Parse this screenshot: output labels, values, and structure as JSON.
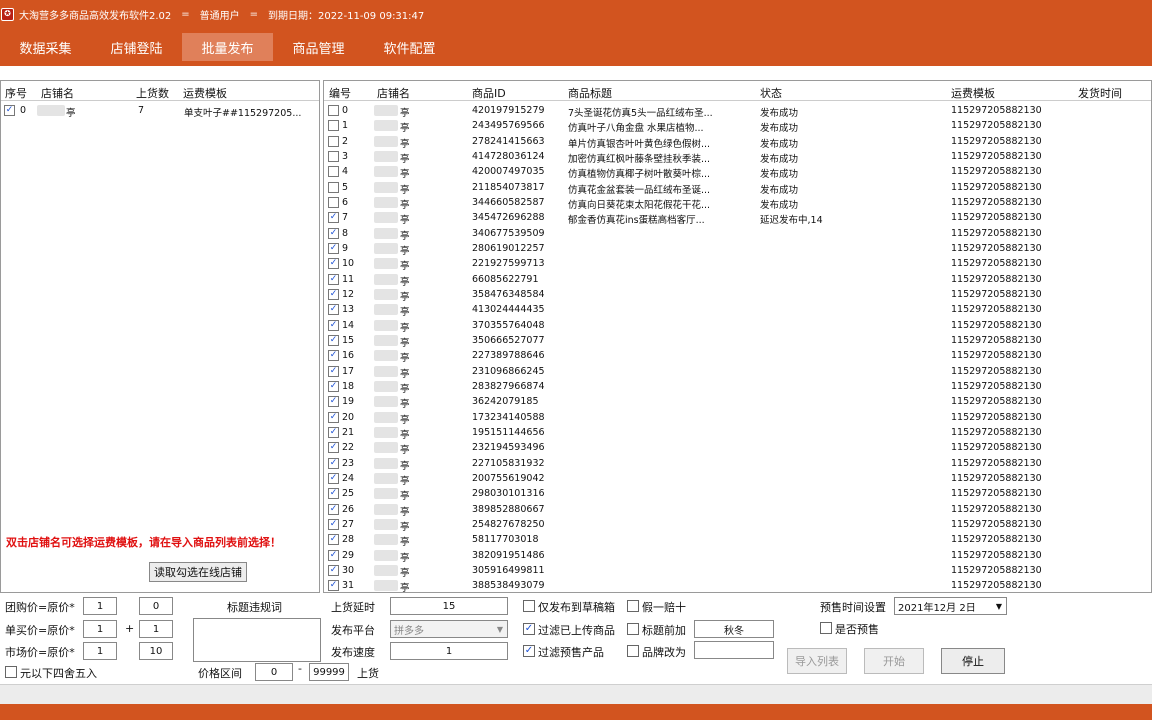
{
  "window": {
    "title": "大淘营多多商品高效发布软件2.02",
    "sep1": "=",
    "user": "普通用户",
    "sep2": "=",
    "expiry": "到期日期：2022-11-09 09:31:47"
  },
  "nav": {
    "tabs": [
      {
        "label": "数据采集"
      },
      {
        "label": "店铺登陆"
      },
      {
        "label": "批量发布",
        "active": true
      },
      {
        "label": "商品管理"
      },
      {
        "label": "软件配置"
      }
    ]
  },
  "left": {
    "columns": [
      "序号",
      "店铺名",
      "上货数",
      "运费模板"
    ],
    "rows": [
      {
        "checked": true,
        "no": "0",
        "shop": "亭",
        "count": "7",
        "template": "单支叶子##115297205..."
      }
    ],
    "hint": "双击店铺名可选择运费模板，请在导入商品列表前选择！",
    "read_button": "读取勾选在线店铺"
  },
  "right": {
    "columns": [
      "编号",
      "店铺名",
      "商品ID",
      "商品标题",
      "状态",
      "运费模板",
      "发货时间"
    ],
    "rows": [
      {
        "checked": false,
        "no": "0",
        "shop": "亭",
        "id": "420197915279",
        "title": "7头圣诞花仿真5头一品红绒布圣...",
        "status": "发布成功",
        "template": "115297205882130"
      },
      {
        "checked": false,
        "no": "1",
        "shop": "亭",
        "id": "243495769566",
        "title": "仿真叶子八角金盘 水果店植物...",
        "status": "发布成功",
        "template": "115297205882130"
      },
      {
        "checked": false,
        "no": "2",
        "shop": "亭",
        "id": "278241415663",
        "title": "单片仿真银杏叶叶黄色绿色假树...",
        "status": "发布成功",
        "template": "115297205882130"
      },
      {
        "checked": false,
        "no": "3",
        "shop": "亭",
        "id": "414728036124",
        "title": "加密仿真红枫叶藤条壁挂秋季装...",
        "status": "发布成功",
        "template": "115297205882130"
      },
      {
        "checked": false,
        "no": "4",
        "shop": "亭",
        "id": "420007497035",
        "title": "仿真植物仿真椰子树叶散葵叶棕...",
        "status": "发布成功",
        "template": "115297205882130"
      },
      {
        "checked": false,
        "no": "5",
        "shop": "亭",
        "id": "211854073817",
        "title": "仿真花金盆套装一品红绒布圣诞...",
        "status": "发布成功",
        "template": "115297205882130"
      },
      {
        "checked": false,
        "no": "6",
        "shop": "亭",
        "id": "344660582587",
        "title": "仿真向日葵花束太阳花假花干花...",
        "status": "发布成功",
        "template": "115297205882130"
      },
      {
        "checked": true,
        "no": "7",
        "shop": "亭",
        "id": "345472696288",
        "title": "郁金香仿真花ins蛋糕高档客厅...",
        "status": "延迟发布中,14",
        "template": "115297205882130"
      },
      {
        "checked": true,
        "no": "8",
        "shop": "亭",
        "id": "340677539509",
        "title": "",
        "status": "",
        "template": "115297205882130"
      },
      {
        "checked": true,
        "no": "9",
        "shop": "亭",
        "id": "280619012257",
        "title": "",
        "status": "",
        "template": "115297205882130"
      },
      {
        "checked": true,
        "no": "10",
        "shop": "亭",
        "id": "221927599713",
        "title": "",
        "status": "",
        "template": "115297205882130"
      },
      {
        "checked": true,
        "no": "11",
        "shop": "亭",
        "id": "66085622791",
        "title": "",
        "status": "",
        "template": "115297205882130"
      },
      {
        "checked": true,
        "no": "12",
        "shop": "亭",
        "id": "358476348584",
        "title": "",
        "status": "",
        "template": "115297205882130"
      },
      {
        "checked": true,
        "no": "13",
        "shop": "亭",
        "id": "413024444435",
        "title": "",
        "status": "",
        "template": "115297205882130"
      },
      {
        "checked": true,
        "no": "14",
        "shop": "亭",
        "id": "370355764048",
        "title": "",
        "status": "",
        "template": "115297205882130"
      },
      {
        "checked": true,
        "no": "15",
        "shop": "亭",
        "id": "350666527077",
        "title": "",
        "status": "",
        "template": "115297205882130"
      },
      {
        "checked": true,
        "no": "16",
        "shop": "亭",
        "id": "227389788646",
        "title": "",
        "status": "",
        "template": "115297205882130"
      },
      {
        "checked": true,
        "no": "17",
        "shop": "亭",
        "id": "231096866245",
        "title": "",
        "status": "",
        "template": "115297205882130"
      },
      {
        "checked": true,
        "no": "18",
        "shop": "亭",
        "id": "283827966874",
        "title": "",
        "status": "",
        "template": "115297205882130"
      },
      {
        "checked": true,
        "no": "19",
        "shop": "亭",
        "id": "36242079185",
        "title": "",
        "status": "",
        "template": "115297205882130"
      },
      {
        "checked": true,
        "no": "20",
        "shop": "亭",
        "id": "173234140588",
        "title": "",
        "status": "",
        "template": "115297205882130"
      },
      {
        "checked": true,
        "no": "21",
        "shop": "亭",
        "id": "195151144656",
        "title": "",
        "status": "",
        "template": "115297205882130"
      },
      {
        "checked": true,
        "no": "22",
        "shop": "亭",
        "id": "232194593496",
        "title": "",
        "status": "",
        "template": "115297205882130"
      },
      {
        "checked": true,
        "no": "23",
        "shop": "亭",
        "id": "227105831932",
        "title": "",
        "status": "",
        "template": "115297205882130"
      },
      {
        "checked": true,
        "no": "24",
        "shop": "亭",
        "id": "200755619042",
        "title": "",
        "status": "",
        "template": "115297205882130"
      },
      {
        "checked": true,
        "no": "25",
        "shop": "亭",
        "id": "298030101316",
        "title": "",
        "status": "",
        "template": "115297205882130"
      },
      {
        "checked": true,
        "no": "26",
        "shop": "亭",
        "id": "389852880667",
        "title": "",
        "status": "",
        "template": "115297205882130"
      },
      {
        "checked": true,
        "no": "27",
        "shop": "亭",
        "id": "254827678250",
        "title": "",
        "status": "",
        "template": "115297205882130"
      },
      {
        "checked": true,
        "no": "28",
        "shop": "亭",
        "id": "58117703018",
        "title": "",
        "status": "",
        "template": "115297205882130"
      },
      {
        "checked": true,
        "no": "29",
        "shop": "亭",
        "id": "382091951486",
        "title": "",
        "status": "",
        "template": "115297205882130"
      },
      {
        "checked": true,
        "no": "30",
        "shop": "亭",
        "id": "305916499811",
        "title": "",
        "status": "",
        "template": "115297205882130"
      },
      {
        "checked": true,
        "no": "31",
        "shop": "亭",
        "id": "388538493079",
        "title": "",
        "status": "",
        "template": "115297205882130"
      }
    ]
  },
  "controls": {
    "group_price_label": "团购价=原价*",
    "group_price_a": "1",
    "group_price_b": "0",
    "single_price_label": "单买价=原价*",
    "single_price_a": "1",
    "plus": "+",
    "single_price_b": "1",
    "market_price_label": "市场价=原价*",
    "market_price_a": "1",
    "market_price_b": "10",
    "round_label": "元以下四舍五入",
    "title_violation_label": "标题违规词",
    "price_range_label": "价格区间",
    "price_min": "0",
    "dash": "-",
    "price_max": "99999",
    "upload_label": "上货",
    "delay_label": "上货延时",
    "delay_value": "15",
    "platform_label": "发布平台",
    "platform_value": "拼多多",
    "speed_label": "发布速度",
    "speed_value": "1",
    "draft_only_label": "仅发布到草稿箱",
    "filter_uploaded_label": "过滤已上传商品",
    "filter_presale_label": "过滤预售产品",
    "fake_one_label": "假一赔十",
    "title_prefix_label": "标题前加",
    "title_prefix_value": "秋冬",
    "brand_change_label": "品牌改为",
    "brand_change_value": "",
    "presale_time_label": "预售时间设置",
    "presale_date": "2021年12月 2日",
    "is_presale_label": "是否预售",
    "import_button": "导入列表",
    "start_button": "开始",
    "stop_button": "停止"
  },
  "colors": {
    "brand": "#d2541f",
    "active_tab": "#e0805a",
    "hint": "#e01010"
  }
}
